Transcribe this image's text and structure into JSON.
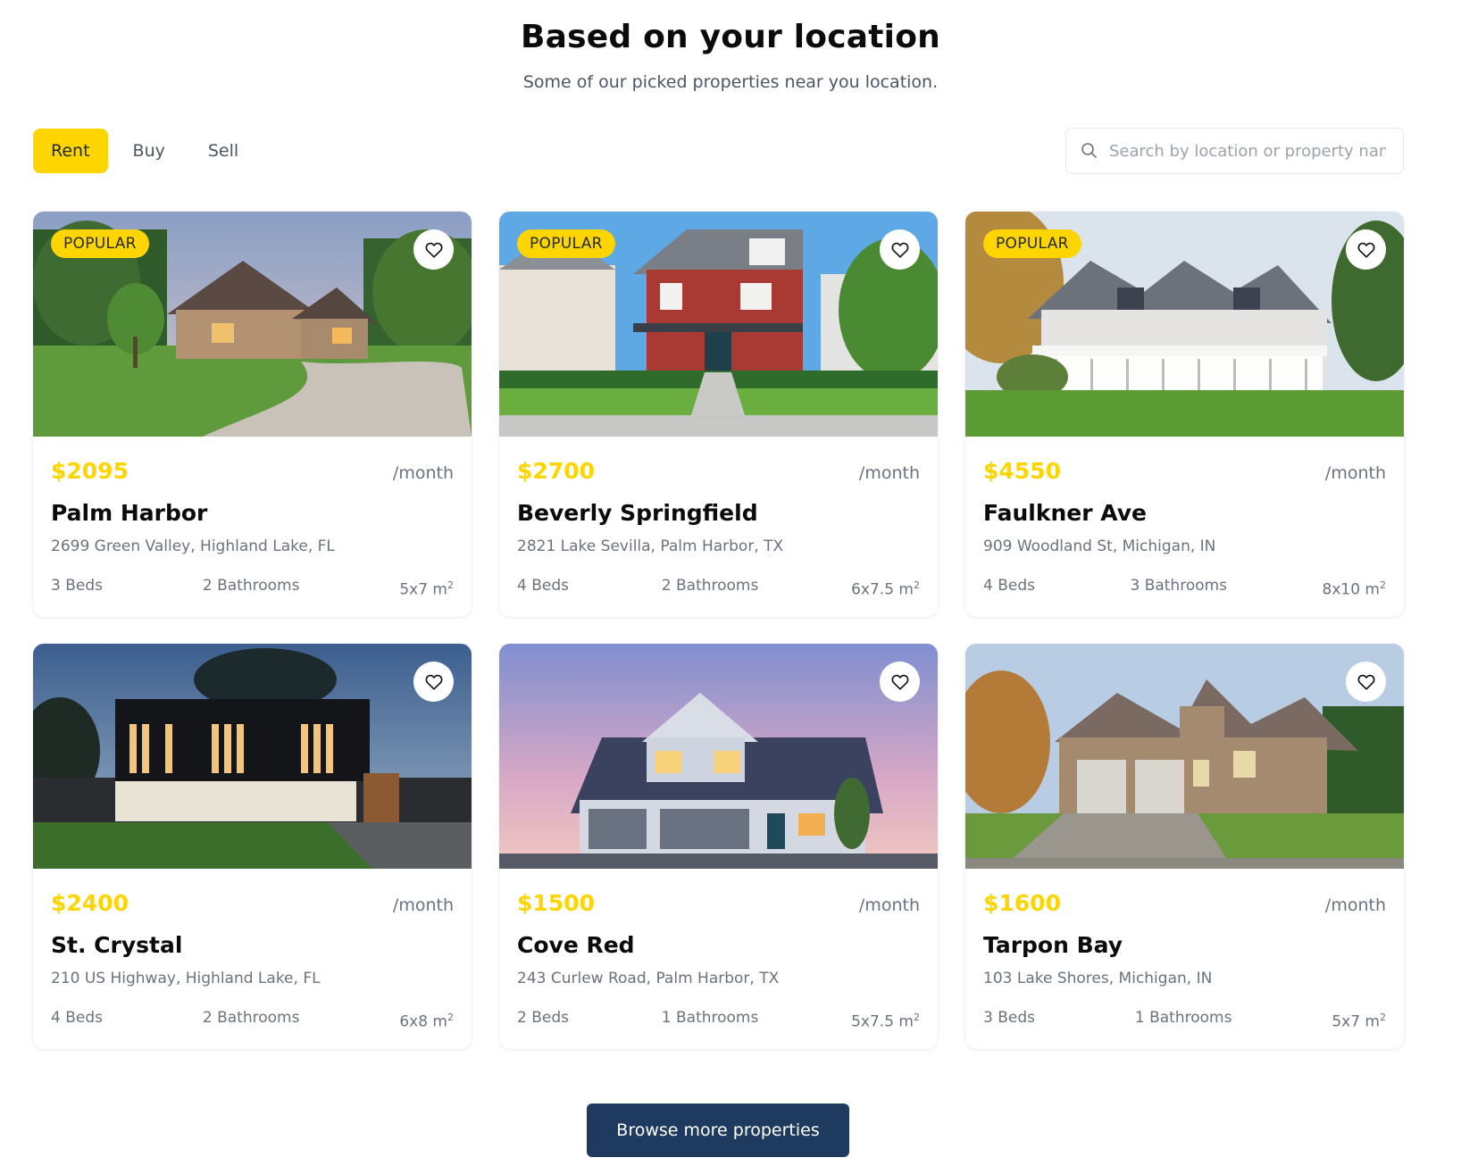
{
  "section": {
    "title": "Based on your location",
    "subtitle": "Some of our picked properties near you location."
  },
  "filters": {
    "tabs": [
      {
        "label": "Rent",
        "active": true
      },
      {
        "label": "Buy",
        "active": false
      },
      {
        "label": "Sell",
        "active": false
      }
    ],
    "search_placeholder": "Search by location or property name",
    "search_icon": "search-icon"
  },
  "colors": {
    "accent": "#FFD500",
    "button": "#1e3a5f",
    "muted_text": "#6b7280"
  },
  "listings": [
    {
      "badge": "POPULAR",
      "price": "$2095",
      "period": "/month",
      "name": "Palm Harbor",
      "address": "2699 Green Valley, Highland Lake, FL",
      "beds": "3 Beds",
      "baths": "2 Bathrooms",
      "area": "5x7 m",
      "area_unit_sup": "2",
      "image": "brick-house-with-driveway"
    },
    {
      "badge": "POPULAR",
      "price": "$2700",
      "period": "/month",
      "name": "Beverly Springfield",
      "address": "2821 Lake Sevilla, Palm Harbor, TX",
      "beds": "4 Beds",
      "baths": "2 Bathrooms",
      "area": "6x7.5 m",
      "area_unit_sup": "2",
      "image": "red-two-storey-house"
    },
    {
      "badge": "POPULAR",
      "price": "$4550",
      "period": "/month",
      "name": "Faulkner Ave",
      "address": "909 Woodland St, Michigan, IN",
      "beds": "4 Beds",
      "baths": "3 Bathrooms",
      "area": "8x10 m",
      "area_unit_sup": "2",
      "image": "white-house-with-porch"
    },
    {
      "badge": "",
      "price": "$2400",
      "period": "/month",
      "name": "St. Crystal",
      "address": "210 US Highway, Highland Lake, FL",
      "beds": "4 Beds",
      "baths": "2 Bathrooms",
      "area": "6x8 m",
      "area_unit_sup": "2",
      "image": "modern-black-house-at-dusk"
    },
    {
      "badge": "",
      "price": "$1500",
      "period": "/month",
      "name": "Cove Red",
      "address": "243 Curlew Road, Palm Harbor, TX",
      "beds": "2 Beds",
      "baths": "1 Bathrooms",
      "area": "5x7.5 m",
      "area_unit_sup": "2",
      "image": "blue-house-with-garage"
    },
    {
      "badge": "",
      "price": "$1600",
      "period": "/month",
      "name": "Tarpon Bay",
      "address": "103 Lake Shores, Michigan, IN",
      "beds": "3 Beds",
      "baths": "1 Bathrooms",
      "area": "5x7 m",
      "area_unit_sup": "2",
      "image": "stone-house-with-double-garage"
    }
  ],
  "browse_button": "Browse more properties"
}
